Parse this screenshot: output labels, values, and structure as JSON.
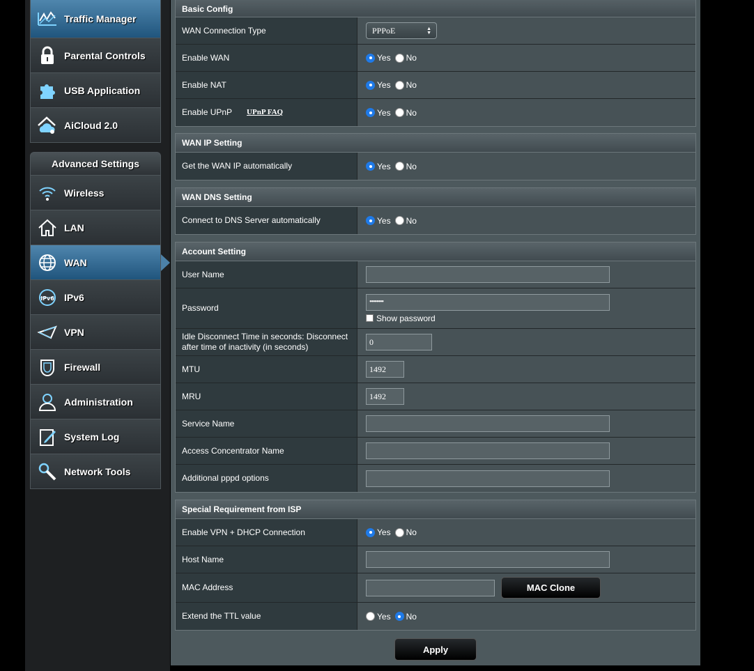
{
  "sidebar": {
    "general_items": [
      {
        "label": "Traffic Manager",
        "icon": "traffic-chart-icon",
        "active": true
      },
      {
        "label": "Parental Controls",
        "icon": "lock-icon"
      },
      {
        "label": "USB Application",
        "icon": "puzzle-icon"
      },
      {
        "label": "AiCloud 2.0",
        "icon": "cloud-home-icon"
      }
    ],
    "advanced_title": "Advanced Settings",
    "advanced_items": [
      {
        "label": "Wireless",
        "icon": "wifi-icon"
      },
      {
        "label": "LAN",
        "icon": "home-icon"
      },
      {
        "label": "WAN",
        "icon": "globe-icon",
        "active": true
      },
      {
        "label": "IPv6",
        "icon": "ipv6-globe-icon"
      },
      {
        "label": "VPN",
        "icon": "vpn-icon"
      },
      {
        "label": "Firewall",
        "icon": "shield-icon"
      },
      {
        "label": "Administration",
        "icon": "user-icon"
      },
      {
        "label": "System Log",
        "icon": "log-edit-icon"
      },
      {
        "label": "Network Tools",
        "icon": "tools-icon"
      }
    ]
  },
  "radio": {
    "yes": "Yes",
    "no": "No"
  },
  "basic": {
    "title": "Basic Config",
    "wan_type_label": "WAN Connection Type",
    "wan_type_value": "PPPoE",
    "enable_wan_label": "Enable WAN",
    "enable_nat_label": "Enable NAT",
    "enable_upnp_label": "Enable UPnP",
    "upnp_faq": "UPnP FAQ"
  },
  "wan_ip": {
    "title": "WAN IP Setting",
    "auto_label": "Get the WAN IP automatically"
  },
  "wan_dns": {
    "title": "WAN DNS Setting",
    "auto_label": "Connect to DNS Server automatically"
  },
  "account": {
    "title": "Account Setting",
    "username_label": "User Name",
    "username_value": "",
    "password_label": "Password",
    "password_value": "••••••••",
    "show_password": "Show password",
    "idle_label": "Idle Disconnect Time in seconds: Disconnect after time of inactivity (in seconds)",
    "idle_value": "0",
    "mtu_label": "MTU",
    "mtu_value": "1492",
    "mru_label": "MRU",
    "mru_value": "1492",
    "service_label": "Service Name",
    "access_label": "Access Concentrator Name",
    "pppd_label": "Additional pppd options"
  },
  "isp": {
    "title": "Special Requirement from ISP",
    "vpn_dhcp_label": "Enable VPN + DHCP Connection",
    "host_label": "Host Name",
    "mac_label": "MAC Address",
    "mac_clone": "MAC Clone",
    "ttl_label": "Extend the TTL value"
  },
  "apply": "Apply",
  "colors": {
    "accent": "#1f7ae8",
    "active_menu": "#2f6590"
  }
}
